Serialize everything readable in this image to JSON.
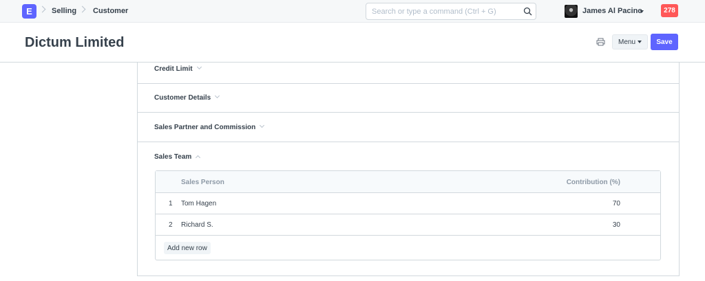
{
  "navbar": {
    "logo": "E",
    "breadcrumbs": [
      "Selling",
      "Customer"
    ],
    "search": {
      "placeholder": "Search or type a command (Ctrl + G)",
      "value": ""
    },
    "user_name": "James Al Pacino",
    "notification_count": "278"
  },
  "page": {
    "title": "Dictum Limited",
    "menu_label": "Menu",
    "save_label": "Save"
  },
  "sections": [
    {
      "label": "Credit Limit",
      "expanded": false
    },
    {
      "label": "Customer Details",
      "expanded": false
    },
    {
      "label": "Sales Partner and Commission",
      "expanded": false
    },
    {
      "label": "Sales Team",
      "expanded": true
    }
  ],
  "sales_team": {
    "columns": [
      "Sales Person",
      "Contribution (%)"
    ],
    "rows": [
      {
        "idx": "1",
        "sales_person": "Tom Hagen",
        "contribution": "70"
      },
      {
        "idx": "2",
        "sales_person": "Richard S.",
        "contribution": "30"
      }
    ],
    "add_row_label": "Add new row"
  },
  "colors": {
    "primary": "#5e64ff",
    "notification": "#ff5858",
    "text": "#36414c",
    "muted": "#8d99a6",
    "border": "#d1d8dd"
  }
}
